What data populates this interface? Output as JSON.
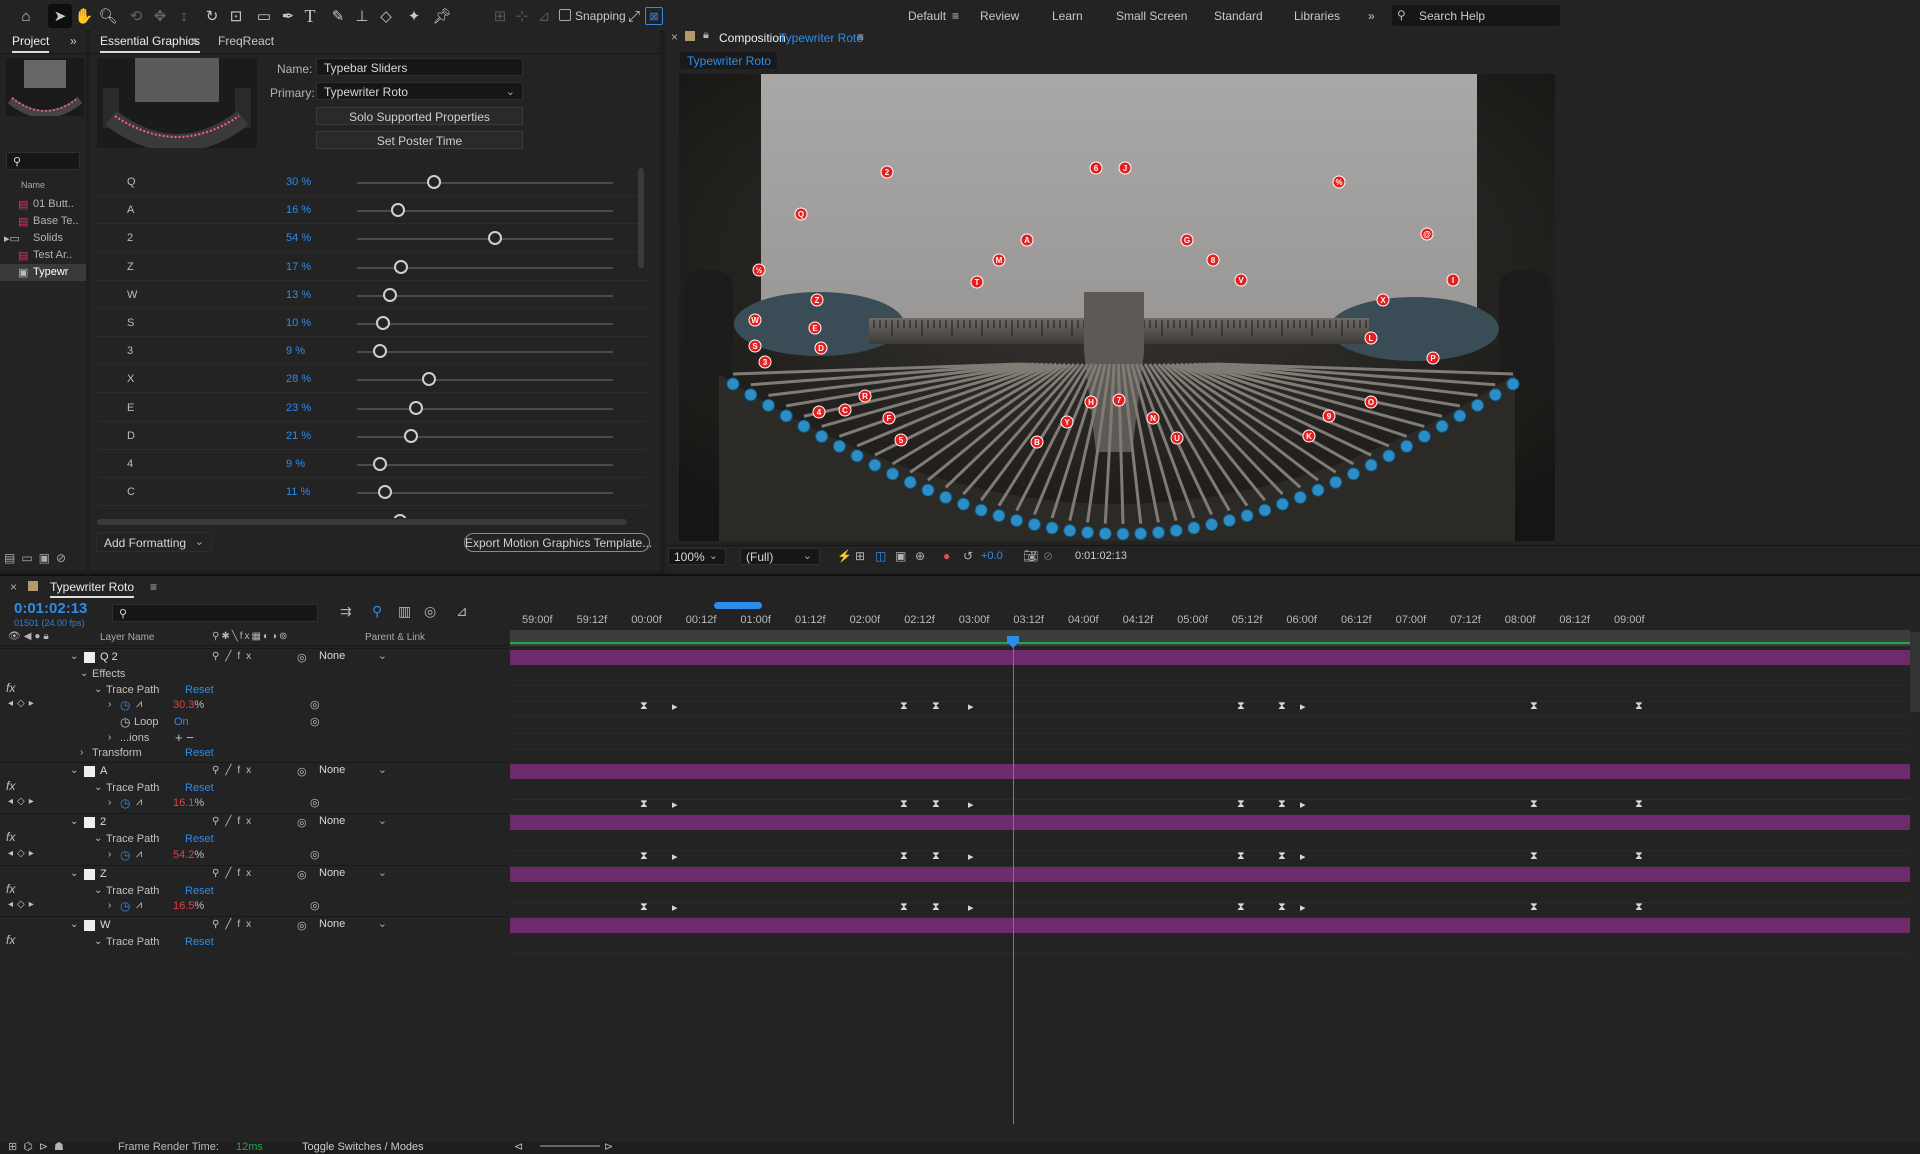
{
  "toolbar": {
    "snapping_label": "Snapping",
    "workspaces": [
      "Default",
      "Review",
      "Learn",
      "Small Screen",
      "Standard",
      "Libraries"
    ],
    "active_workspace": "Default",
    "search_placeholder": "Search Help"
  },
  "project": {
    "tab": "Project",
    "search_placeholder": "",
    "column_name": "Name",
    "items": [
      {
        "label": "01 Butt..",
        "icon": "document-icon"
      },
      {
        "label": "Base Te..",
        "icon": "document-icon"
      },
      {
        "label": "Solids",
        "icon": "folder-icon"
      },
      {
        "label": "Test Ar..",
        "icon": "document-icon"
      },
      {
        "label": "Typewr",
        "icon": "composition-icon"
      }
    ]
  },
  "essential_graphics": {
    "tabs": [
      "Essential Graphics",
      "FreqReact"
    ],
    "name_label": "Name:",
    "name_value": "Typebar Sliders",
    "primary_label": "Primary:",
    "primary_value": "Typewriter Roto",
    "solo_button": "Solo Supported Properties",
    "poster_button": "Set Poster Time",
    "add_formatting": "Add Formatting",
    "export_button": "Export Motion Graphics Template...",
    "sliders": [
      {
        "label": "Q",
        "value": 30,
        "unit": "%"
      },
      {
        "label": "A",
        "value": 16,
        "unit": "%"
      },
      {
        "label": "2",
        "value": 54,
        "unit": "%"
      },
      {
        "label": "Z",
        "value": 17,
        "unit": "%"
      },
      {
        "label": "W",
        "value": 13,
        "unit": "%"
      },
      {
        "label": "S",
        "value": 10,
        "unit": "%"
      },
      {
        "label": "3",
        "value": 9,
        "unit": "%"
      },
      {
        "label": "X",
        "value": 28,
        "unit": "%"
      },
      {
        "label": "E",
        "value": 23,
        "unit": "%"
      },
      {
        "label": "D",
        "value": 21,
        "unit": "%"
      },
      {
        "label": "4",
        "value": 9,
        "unit": "%"
      },
      {
        "label": "C",
        "value": 11,
        "unit": "%"
      }
    ]
  },
  "composition": {
    "tab_prefix": "Composition",
    "tab_name": "Typewriter Roto",
    "subtab": "Typewriter Roto",
    "zoom": "100%",
    "resolution": "(Full)",
    "exposure": "+0.0",
    "timecode": "0:01:02:13",
    "markers": [
      "2",
      "6",
      "J",
      "%",
      "Q",
      "@",
      "A",
      "G",
      "8",
      "M",
      "T",
      "V",
      "I",
      "½",
      "Z",
      "X",
      "W",
      "E",
      "S",
      "D",
      "3",
      "L",
      "R",
      "4",
      "C",
      "F",
      "H",
      "7",
      "9",
      "O",
      "5",
      "N",
      "B",
      "Y",
      "U",
      "K",
      "P"
    ]
  },
  "timeline": {
    "comp_tab": "Typewriter Roto",
    "timecode": "0:01:02:13",
    "frame_info": "01501 (24.00 fps)",
    "col_layer_name": "Layer Name",
    "col_parent": "Parent & Link",
    "ruler": [
      "59:00f",
      "59:12f",
      "00:00f",
      "00:12f",
      "01:00f",
      "01:12f",
      "02:00f",
      "02:12f",
      "03:00f",
      "03:12f",
      "04:00f",
      "04:12f",
      "05:00f",
      "05:12f",
      "06:00f",
      "06:12f",
      "07:00f",
      "07:12f",
      "08:00f",
      "08:12f",
      "09:00f"
    ],
    "rows": [
      {
        "kind": "layer",
        "indent": 0,
        "name": "Q 2",
        "parent": "None"
      },
      {
        "kind": "group",
        "indent": 1,
        "name": "Effects"
      },
      {
        "kind": "effect",
        "indent": 2,
        "name": "Trace Path",
        "reset": "Reset"
      },
      {
        "kind": "prop",
        "indent": 3,
        "value": "30.3",
        "unit": "%"
      },
      {
        "kind": "loop",
        "indent": 3,
        "name": "Loop",
        "value": "On"
      },
      {
        "kind": "group",
        "indent": 3,
        "name": "...ions"
      },
      {
        "kind": "effect",
        "indent": 1,
        "name": "Transform",
        "reset": "Reset"
      },
      {
        "kind": "layer",
        "indent": 0,
        "name": "A",
        "parent": "None"
      },
      {
        "kind": "effect",
        "indent": 2,
        "name": "Trace Path",
        "reset": "Reset"
      },
      {
        "kind": "prop",
        "indent": 3,
        "value": "16.1",
        "unit": "%"
      },
      {
        "kind": "layer",
        "indent": 0,
        "name": "2",
        "parent": "None"
      },
      {
        "kind": "effect",
        "indent": 2,
        "name": "Trace Path",
        "reset": "Reset"
      },
      {
        "kind": "prop",
        "indent": 3,
        "value": "54.2",
        "unit": "%"
      },
      {
        "kind": "layer",
        "indent": 0,
        "name": "Z",
        "parent": "None"
      },
      {
        "kind": "effect",
        "indent": 2,
        "name": "Trace Path",
        "reset": "Reset"
      },
      {
        "kind": "prop",
        "indent": 3,
        "value": "16.5",
        "unit": "%"
      },
      {
        "kind": "layer",
        "indent": 0,
        "name": "W",
        "parent": "None"
      },
      {
        "kind": "effect",
        "indent": 2,
        "name": "Trace Path",
        "reset": "Reset"
      }
    ],
    "footer_render_label": "Frame Render Time:",
    "footer_render_value": "12ms",
    "footer_toggle": "Toggle Switches / Modes"
  }
}
